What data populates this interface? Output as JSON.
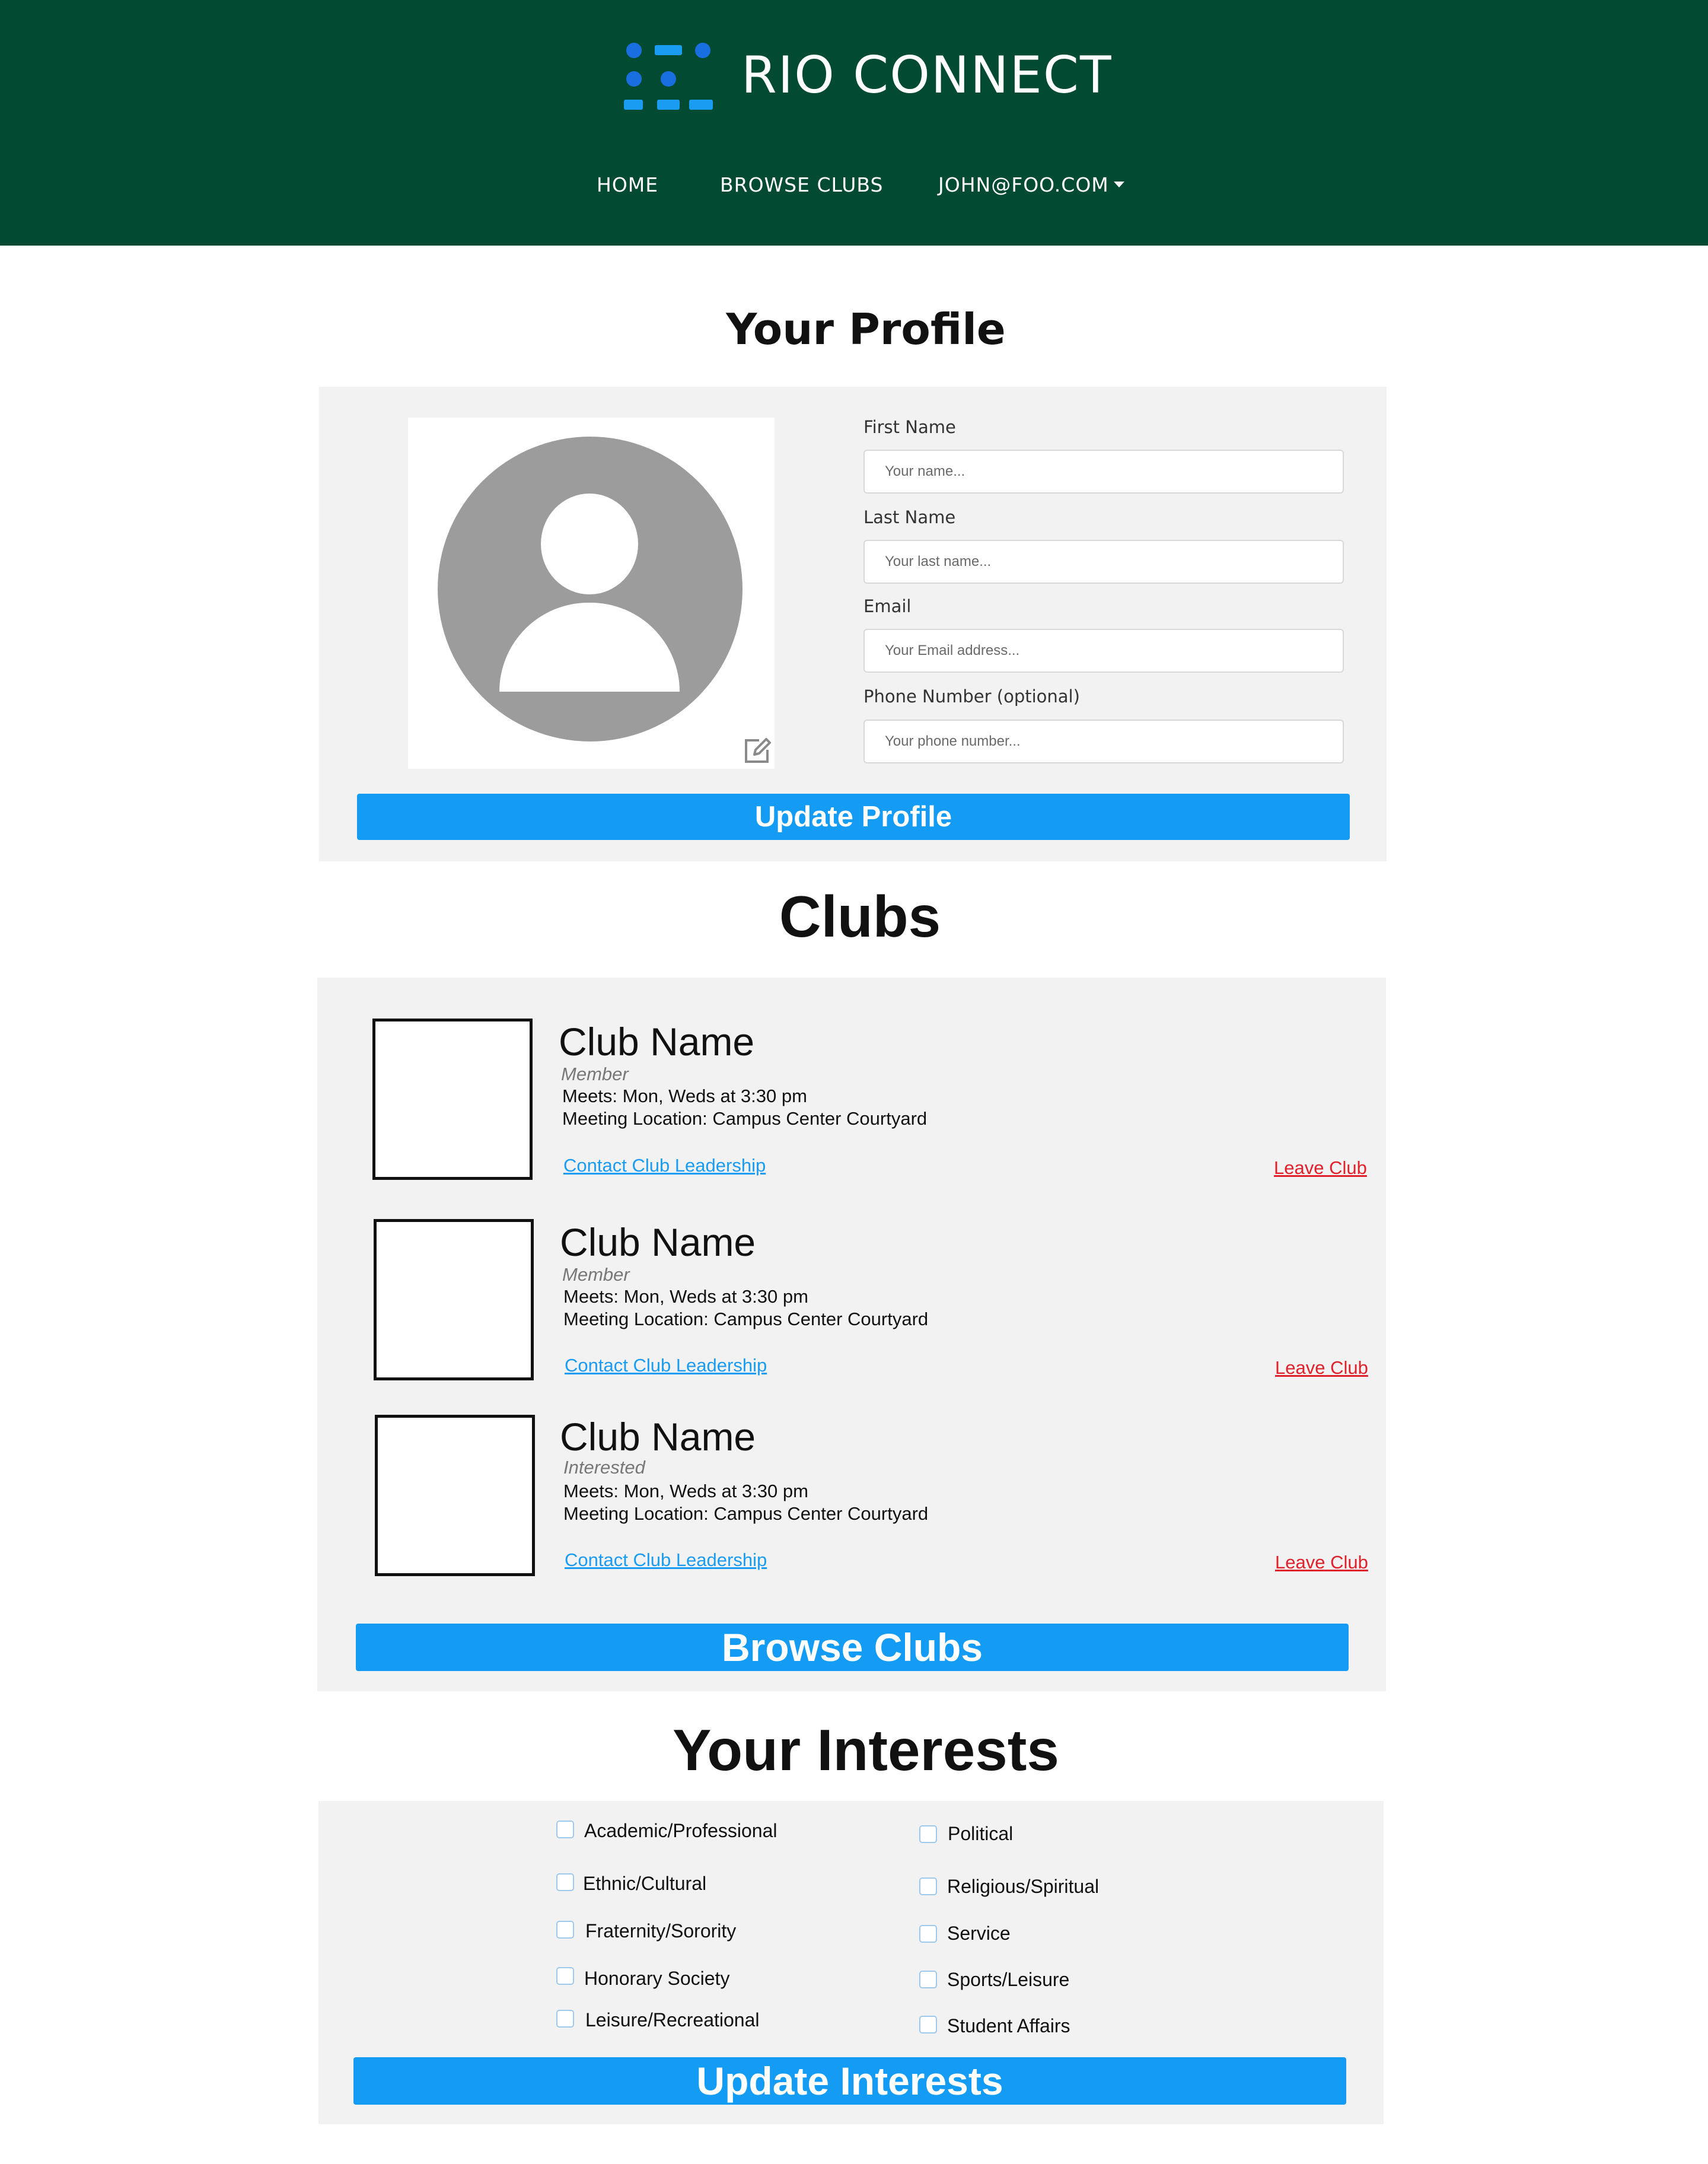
{
  "header": {
    "brand": "RIO CONNECT",
    "nav": {
      "home": "HOME",
      "browse": "BROWSE CLUBS",
      "user": "JOHN@FOO.COM"
    },
    "colors": {
      "background": "#034a33",
      "logo_blue": "#1a6fe0",
      "logo_light_blue": "#1a9cf2"
    }
  },
  "profile": {
    "title": "Your Profile",
    "fields": [
      {
        "label": "First Name",
        "placeholder": "Your name..."
      },
      {
        "label": "Last Name",
        "placeholder": "Your last name..."
      },
      {
        "label": "Email",
        "placeholder": "Your Email address..."
      },
      {
        "label": "Phone Number (optional)",
        "placeholder": "Your phone number..."
      }
    ],
    "avatar_icon": "default-user-icon",
    "edit_icon": "edit-icon",
    "button": "Update Profile"
  },
  "clubs": {
    "title": "Clubs",
    "items": [
      {
        "name": "Club Name",
        "status": "Member",
        "meets": "Meets: Mon, Weds at 3:30 pm",
        "location": "Meeting Location: Campus Center Courtyard",
        "contact": "Contact Club Leadership",
        "leave": "Leave Club"
      },
      {
        "name": "Club Name",
        "status": "Member",
        "meets": "Meets: Mon, Weds at 3:30 pm",
        "location": "Meeting Location: Campus Center Courtyard",
        "contact": "Contact Club Leadership",
        "leave": "Leave Club"
      },
      {
        "name": "Club Name",
        "status": "Interested",
        "meets": "Meets: Mon, Weds at 3:30 pm",
        "location": "Meeting Location: Campus Center Courtyard",
        "contact": "Contact Club Leadership",
        "leave": "Leave Club"
      }
    ],
    "button": "Browse Clubs"
  },
  "interests": {
    "title": "Your Interests",
    "left": [
      "Academic/Professional",
      "Ethnic/Cultural",
      "Fraternity/Sorority",
      "Honorary Society",
      "Leisure/Recreational"
    ],
    "right": [
      "Political",
      "Religious/Spiritual",
      "Service",
      "Sports/Leisure",
      "Student Affairs"
    ],
    "button": "Update Interests"
  },
  "colors": {
    "button": "#149cf4",
    "panel": "#f2f2f2",
    "link": "#1a9cf2",
    "leave_link": "#e0202a"
  }
}
